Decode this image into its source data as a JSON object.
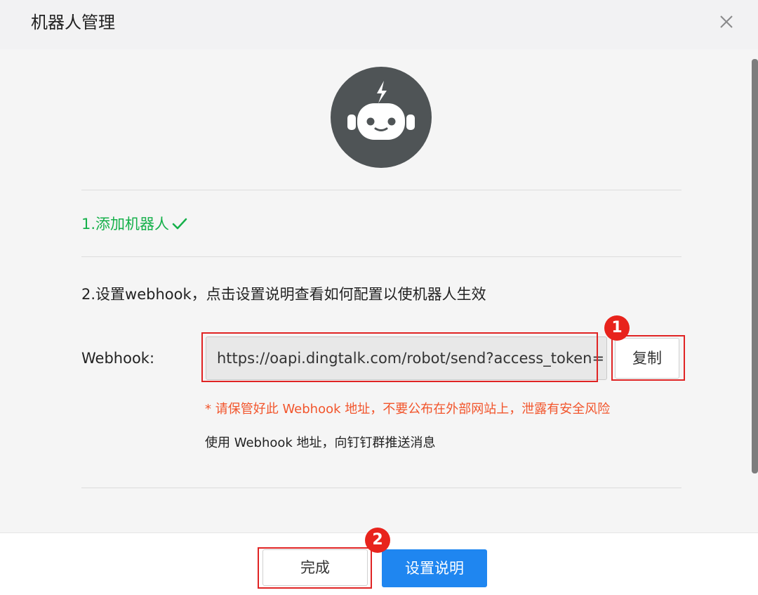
{
  "dialog": {
    "title": "机器人管理"
  },
  "steps": {
    "step1_label": "1.添加机器人",
    "step2_label": "2.设置webhook，点击设置说明查看如何配置以使机器人生效"
  },
  "webhook": {
    "label": "Webhook:",
    "value": "https://oapi.dingtalk.com/robot/send?access_token=",
    "copy_label": "复制",
    "warning": "* 请保管好此 Webhook 地址，不要公布在外部网站上，泄露有安全风险",
    "info": "使用 Webhook 地址，向钉钉群推送消息"
  },
  "footer": {
    "done_label": "完成",
    "guide_label": "设置说明"
  },
  "markers": {
    "one": "1",
    "two": "2"
  },
  "colors": {
    "success": "#15b04a",
    "warning": "#f2552c",
    "primary": "#1f86f0",
    "annotation": "#e02424",
    "avatar_bg": "#4f5456"
  },
  "icons": {
    "close": "close-icon",
    "robot": "robot-icon",
    "check": "check-icon"
  }
}
